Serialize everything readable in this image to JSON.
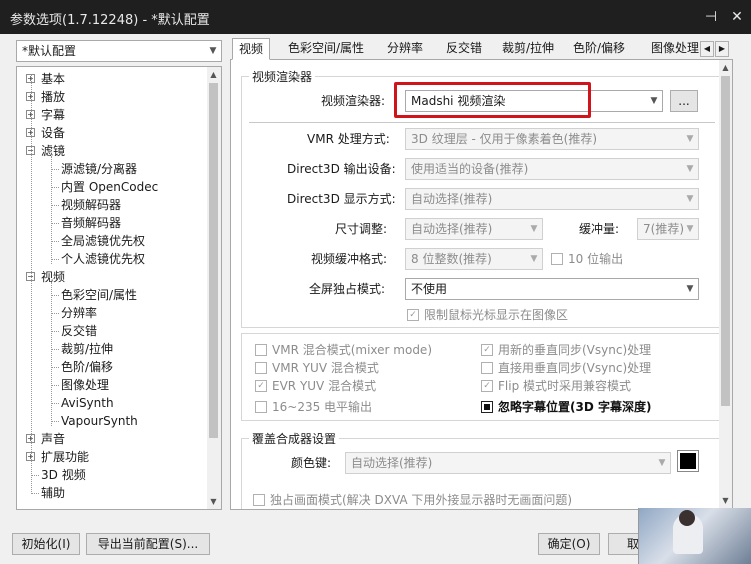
{
  "window": {
    "title": "参数选项(1.7.12248) - *默认配置"
  },
  "profile": {
    "selected": "*默认配置"
  },
  "tree": [
    {
      "label": "基本",
      "level": 0,
      "expander": "plus"
    },
    {
      "label": "播放",
      "level": 0,
      "expander": "plus"
    },
    {
      "label": "字幕",
      "level": 0,
      "expander": "plus"
    },
    {
      "label": "设备",
      "level": 0,
      "expander": "plus"
    },
    {
      "label": "滤镜",
      "level": 0,
      "expander": "minus"
    },
    {
      "label": "源滤镜/分离器",
      "level": 1
    },
    {
      "label": "内置 OpenCodec",
      "level": 1
    },
    {
      "label": "视频解码器",
      "level": 1
    },
    {
      "label": "音频解码器",
      "level": 1
    },
    {
      "label": "全局滤镜优先权",
      "level": 1
    },
    {
      "label": "个人滤镜优先权",
      "level": 1
    },
    {
      "label": "视频",
      "level": 0,
      "expander": "minus"
    },
    {
      "label": "色彩空间/属性",
      "level": 1
    },
    {
      "label": "分辨率",
      "level": 1
    },
    {
      "label": "反交错",
      "level": 1
    },
    {
      "label": "裁剪/拉伸",
      "level": 1
    },
    {
      "label": "色阶/偏移",
      "level": 1
    },
    {
      "label": "图像处理",
      "level": 1
    },
    {
      "label": "AviSynth",
      "level": 1
    },
    {
      "label": "VapourSynth",
      "level": 1
    },
    {
      "label": "声音",
      "level": 0,
      "expander": "plus"
    },
    {
      "label": "扩展功能",
      "level": 0,
      "expander": "plus"
    },
    {
      "label": "3D 视频",
      "level": 0
    },
    {
      "label": "辅助",
      "level": 0
    }
  ],
  "tabs": [
    "视频",
    "色彩空间/属性",
    "分辨率",
    "反交错",
    "裁剪/拉伸",
    "色阶/偏移",
    "图像处理"
  ],
  "video_renderer": {
    "group_title": "视频渲染器",
    "renderer_label": "视频渲染器:",
    "renderer_value": "Madshi 视频渲染",
    "more_button": "...",
    "vmr_mode_label": "VMR 处理方式:",
    "vmr_mode_value": "3D 纹理层 - 仅用于像素着色(推荐)",
    "d3d_device_label": "Direct3D 输出设备:",
    "d3d_device_value": "使用适当的设备(推荐)",
    "d3d_display_label": "Direct3D 显示方式:",
    "d3d_display_value": "自动选择(推荐)",
    "resize_label": "尺寸调整:",
    "resize_value": "自动选择(推荐)",
    "buffer_label": "缓冲量:",
    "buffer_value": "7(推荐)",
    "buffer_format_label": "视频缓冲格式:",
    "buffer_format_value": "8 位整数(推荐)",
    "ten_bit_label": "10 位输出",
    "fullscreen_label": "全屏独占模式:",
    "fullscreen_value": "不使用",
    "limit_cursor_label": "限制鼠标光标显示在图像区"
  },
  "options": {
    "vmr_mixer": "VMR 混合模式(mixer mode)",
    "vmr_yuv": "VMR YUV 混合模式",
    "evr_yuv": "EVR YUV 混合模式",
    "range_16_235": "16~235 电平输出",
    "new_vsync": "用新的垂直同步(Vsync)处理",
    "direct_vsync": "直接用垂直同步(Vsync)处理",
    "flip_mode": "Flip 模式时采用兼容模式",
    "ignore_subtitle": "忽略字幕位置(3D 字幕深度)"
  },
  "overlay": {
    "group_title": "覆盖合成器设置",
    "color_key_label": "颜色键:",
    "color_key_value": "自动选择(推荐)",
    "color_key_swatch": "#000000",
    "exclusive_label": "独占画面模式(解决 DXVA 下用外接显示器时无画面问题)"
  },
  "buttons": {
    "init": "初始化(I)",
    "export": "导出当前配置(S)...",
    "ok": "确定(O)",
    "cancel": "取消"
  },
  "colors": {
    "highlight": "#d0141b",
    "titlebar": "#1f1f1f"
  }
}
